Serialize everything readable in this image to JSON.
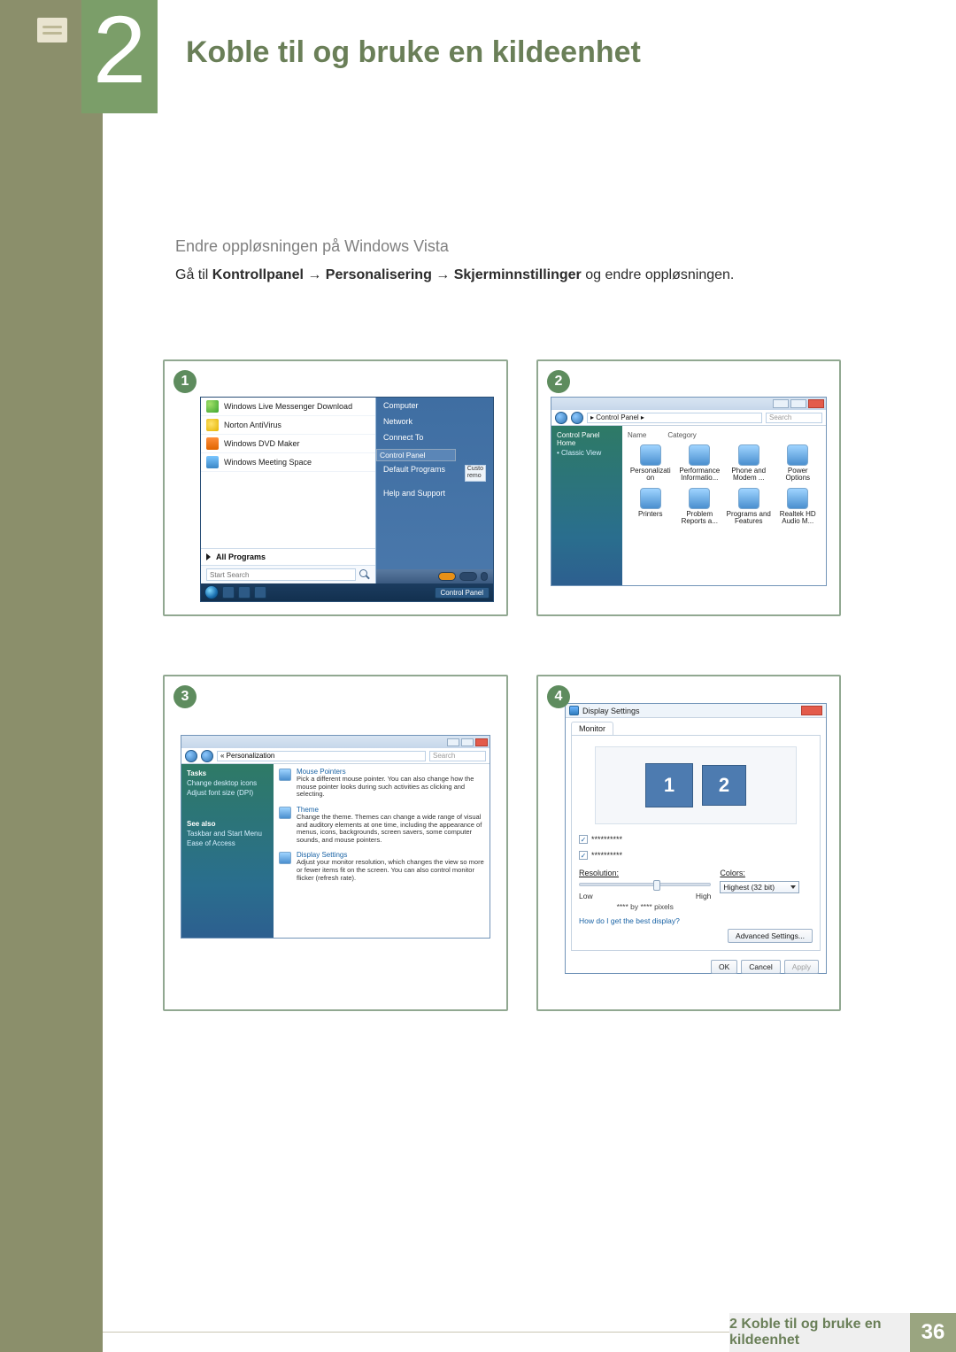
{
  "chapter_number": "2",
  "page_title": "Koble til og bruke en kildeenhet",
  "section_heading": "Endre oppløsningen på Windows Vista",
  "body": {
    "pre": "Gå til ",
    "b1": "Kontrollpanel",
    "arrow": " → ",
    "b2": "Personalisering",
    "b3": "Skjerminnstillinger",
    "post": " og endre oppløsningen."
  },
  "badges": {
    "n1": "1",
    "n2": "2",
    "n3": "3",
    "n4": "4"
  },
  "start_menu": {
    "left_items": [
      "Windows Live Messenger Download",
      "Norton AntiVirus",
      "Windows DVD Maker",
      "Windows Meeting Space"
    ],
    "all_programs": "All Programs",
    "search_placeholder": "Start Search",
    "right_items": [
      "Computer",
      "Network",
      "Connect To",
      "Control Panel",
      "Default Programs",
      "Help and Support"
    ],
    "right_side": {
      "custo": "Custo",
      "remo": "remo"
    },
    "taskbar_label": "Control Panel"
  },
  "control_panel": {
    "breadcrumb": "▸ Control Panel ▸",
    "search_placeholder": "Search",
    "side_home": "Control Panel Home",
    "side_classic": "Classic View",
    "header_name": "Name",
    "header_category": "Category",
    "icons": [
      "Personalizati on",
      "Performance Informatio...",
      "Phone and Modem ...",
      "Power Options",
      "Printers",
      "Problem Reports a...",
      "Programs and Features",
      "Realtek HD Audio M..."
    ]
  },
  "personalization": {
    "breadcrumb": "« Personalization",
    "search_placeholder": "Search",
    "side": {
      "tasks": "Tasks",
      "change_icons": "Change desktop icons",
      "adjust_font": "Adjust font size (DPI)",
      "see_also": "See also",
      "taskbar_menu": "Taskbar and Start Menu",
      "ease": "Ease of Access"
    },
    "blocks": [
      {
        "title": "Mouse Pointers",
        "desc": "Pick a different mouse pointer. You can also change how the mouse pointer looks during such activities as clicking and selecting."
      },
      {
        "title": "Theme",
        "desc": "Change the theme. Themes can change a wide range of visual and auditory elements at one time, including the appearance of menus, icons, backgrounds, screen savers, some computer sounds, and mouse pointers."
      },
      {
        "title": "Display Settings",
        "desc": "Adjust your monitor resolution, which changes the view so more or fewer items fit on the screen. You can also control monitor flicker (refresh rate)."
      }
    ]
  },
  "display_settings": {
    "title": "Display Settings",
    "tab": "Monitor",
    "mon1": "1",
    "mon2": "2",
    "ident_a": "**********",
    "ident_b": "**********",
    "resolution_label": "Resolution:",
    "low": "Low",
    "high": "High",
    "pixels_line": "**** by **** pixels",
    "colors_label": "Colors:",
    "colors_value": "Highest (32 bit)",
    "link": "How do I get the best display?",
    "advanced": "Advanced Settings...",
    "ok": "OK",
    "cancel": "Cancel",
    "apply": "Apply"
  },
  "footer": {
    "text": "2 Koble til og bruke en kildeenhet",
    "page": "36"
  }
}
